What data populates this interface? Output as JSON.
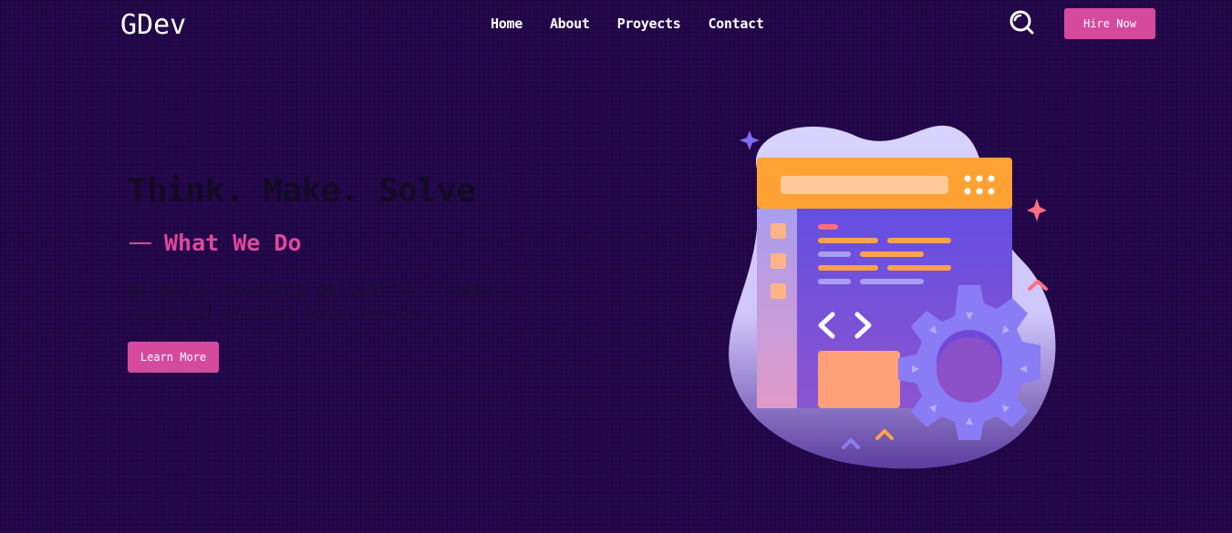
{
  "header": {
    "logo": "GDev",
    "nav": [
      {
        "label": "Home"
      },
      {
        "label": "About"
      },
      {
        "label": "Proyects"
      },
      {
        "label": "Contact"
      }
    ],
    "search_icon": "search-icon",
    "hire_label": "Hire Now"
  },
  "hero": {
    "title": "Think. Make. Solve",
    "subtitle": "What We Do",
    "description": "We enjoy creating delightful, human-centered digital experiences.",
    "cta_label": "Learn More",
    "illustration_icon": "web-development-illustration"
  },
  "colors": {
    "background": "#26084f",
    "accent": "#d64a9e",
    "subtitle": "#e0479f",
    "title_text": "#120a24",
    "nav_text": "#ffffff"
  }
}
